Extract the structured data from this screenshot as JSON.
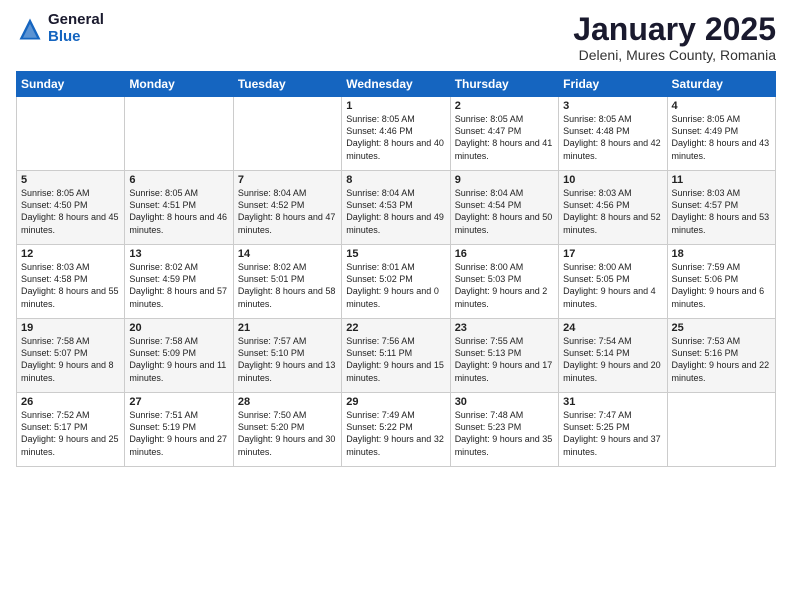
{
  "logo": {
    "general": "General",
    "blue": "Blue"
  },
  "header": {
    "title": "January 2025",
    "subtitle": "Deleni, Mures County, Romania"
  },
  "weekdays": [
    "Sunday",
    "Monday",
    "Tuesday",
    "Wednesday",
    "Thursday",
    "Friday",
    "Saturday"
  ],
  "weeks": [
    [
      {
        "day": "",
        "info": ""
      },
      {
        "day": "",
        "info": ""
      },
      {
        "day": "",
        "info": ""
      },
      {
        "day": "1",
        "info": "Sunrise: 8:05 AM\nSunset: 4:46 PM\nDaylight: 8 hours\nand 40 minutes."
      },
      {
        "day": "2",
        "info": "Sunrise: 8:05 AM\nSunset: 4:47 PM\nDaylight: 8 hours\nand 41 minutes."
      },
      {
        "day": "3",
        "info": "Sunrise: 8:05 AM\nSunset: 4:48 PM\nDaylight: 8 hours\nand 42 minutes."
      },
      {
        "day": "4",
        "info": "Sunrise: 8:05 AM\nSunset: 4:49 PM\nDaylight: 8 hours\nand 43 minutes."
      }
    ],
    [
      {
        "day": "5",
        "info": "Sunrise: 8:05 AM\nSunset: 4:50 PM\nDaylight: 8 hours\nand 45 minutes."
      },
      {
        "day": "6",
        "info": "Sunrise: 8:05 AM\nSunset: 4:51 PM\nDaylight: 8 hours\nand 46 minutes."
      },
      {
        "day": "7",
        "info": "Sunrise: 8:04 AM\nSunset: 4:52 PM\nDaylight: 8 hours\nand 47 minutes."
      },
      {
        "day": "8",
        "info": "Sunrise: 8:04 AM\nSunset: 4:53 PM\nDaylight: 8 hours\nand 49 minutes."
      },
      {
        "day": "9",
        "info": "Sunrise: 8:04 AM\nSunset: 4:54 PM\nDaylight: 8 hours\nand 50 minutes."
      },
      {
        "day": "10",
        "info": "Sunrise: 8:03 AM\nSunset: 4:56 PM\nDaylight: 8 hours\nand 52 minutes."
      },
      {
        "day": "11",
        "info": "Sunrise: 8:03 AM\nSunset: 4:57 PM\nDaylight: 8 hours\nand 53 minutes."
      }
    ],
    [
      {
        "day": "12",
        "info": "Sunrise: 8:03 AM\nSunset: 4:58 PM\nDaylight: 8 hours\nand 55 minutes."
      },
      {
        "day": "13",
        "info": "Sunrise: 8:02 AM\nSunset: 4:59 PM\nDaylight: 8 hours\nand 57 minutes."
      },
      {
        "day": "14",
        "info": "Sunrise: 8:02 AM\nSunset: 5:01 PM\nDaylight: 8 hours\nand 58 minutes."
      },
      {
        "day": "15",
        "info": "Sunrise: 8:01 AM\nSunset: 5:02 PM\nDaylight: 9 hours\nand 0 minutes."
      },
      {
        "day": "16",
        "info": "Sunrise: 8:00 AM\nSunset: 5:03 PM\nDaylight: 9 hours\nand 2 minutes."
      },
      {
        "day": "17",
        "info": "Sunrise: 8:00 AM\nSunset: 5:05 PM\nDaylight: 9 hours\nand 4 minutes."
      },
      {
        "day": "18",
        "info": "Sunrise: 7:59 AM\nSunset: 5:06 PM\nDaylight: 9 hours\nand 6 minutes."
      }
    ],
    [
      {
        "day": "19",
        "info": "Sunrise: 7:58 AM\nSunset: 5:07 PM\nDaylight: 9 hours\nand 8 minutes."
      },
      {
        "day": "20",
        "info": "Sunrise: 7:58 AM\nSunset: 5:09 PM\nDaylight: 9 hours\nand 11 minutes."
      },
      {
        "day": "21",
        "info": "Sunrise: 7:57 AM\nSunset: 5:10 PM\nDaylight: 9 hours\nand 13 minutes."
      },
      {
        "day": "22",
        "info": "Sunrise: 7:56 AM\nSunset: 5:11 PM\nDaylight: 9 hours\nand 15 minutes."
      },
      {
        "day": "23",
        "info": "Sunrise: 7:55 AM\nSunset: 5:13 PM\nDaylight: 9 hours\nand 17 minutes."
      },
      {
        "day": "24",
        "info": "Sunrise: 7:54 AM\nSunset: 5:14 PM\nDaylight: 9 hours\nand 20 minutes."
      },
      {
        "day": "25",
        "info": "Sunrise: 7:53 AM\nSunset: 5:16 PM\nDaylight: 9 hours\nand 22 minutes."
      }
    ],
    [
      {
        "day": "26",
        "info": "Sunrise: 7:52 AM\nSunset: 5:17 PM\nDaylight: 9 hours\nand 25 minutes."
      },
      {
        "day": "27",
        "info": "Sunrise: 7:51 AM\nSunset: 5:19 PM\nDaylight: 9 hours\nand 27 minutes."
      },
      {
        "day": "28",
        "info": "Sunrise: 7:50 AM\nSunset: 5:20 PM\nDaylight: 9 hours\nand 30 minutes."
      },
      {
        "day": "29",
        "info": "Sunrise: 7:49 AM\nSunset: 5:22 PM\nDaylight: 9 hours\nand 32 minutes."
      },
      {
        "day": "30",
        "info": "Sunrise: 7:48 AM\nSunset: 5:23 PM\nDaylight: 9 hours\nand 35 minutes."
      },
      {
        "day": "31",
        "info": "Sunrise: 7:47 AM\nSunset: 5:25 PM\nDaylight: 9 hours\nand 37 minutes."
      },
      {
        "day": "",
        "info": ""
      }
    ]
  ]
}
